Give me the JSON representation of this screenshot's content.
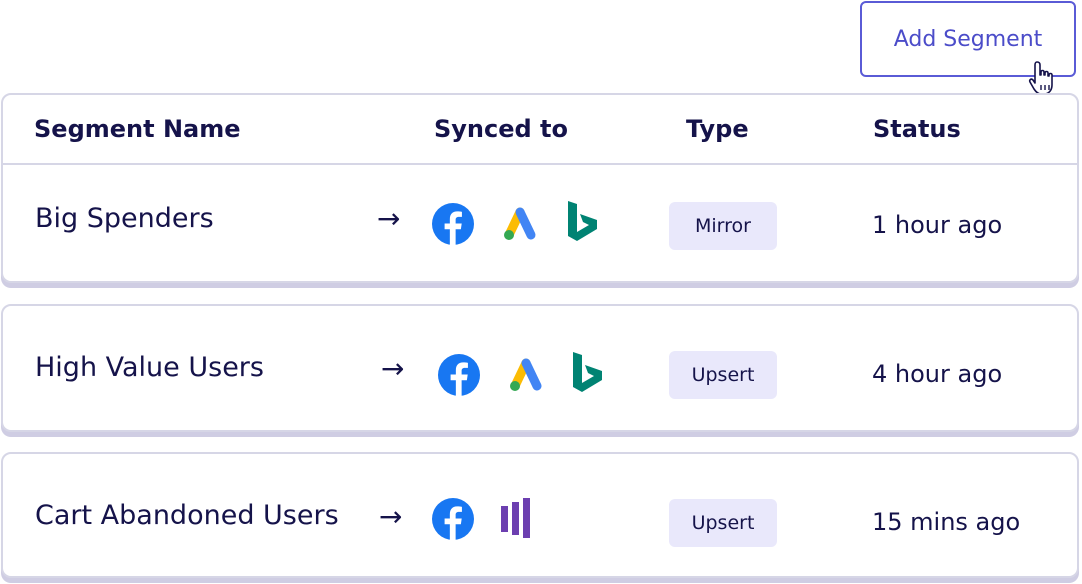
{
  "toolbar": {
    "add_segment_label": "Add Segment"
  },
  "table": {
    "columns": [
      "Segment Name",
      "Synced to",
      "Type",
      "Status"
    ],
    "rows": [
      {
        "name": "Big Spenders",
        "destinations": [
          "facebook-icon",
          "google-ads-icon",
          "bing-icon"
        ],
        "type": "Mirror",
        "status": "1 hour ago"
      },
      {
        "name": "High Value Users",
        "destinations": [
          "facebook-icon",
          "google-ads-icon",
          "bing-icon"
        ],
        "type": "Upsert",
        "status": "4 hour ago"
      },
      {
        "name": "Cart Abandoned Users",
        "destinations": [
          "facebook-icon",
          "mixpanel-icon"
        ],
        "type": "Upsert",
        "status": "15 mins ago"
      }
    ]
  },
  "arrow_glyph": "→",
  "colors": {
    "accent": "#4b4cc9",
    "text": "#15134a",
    "badge_bg": "#e9e8fb",
    "facebook": "#1877f2",
    "bing": "#008373",
    "mixpanel": "#6c3fb0"
  }
}
